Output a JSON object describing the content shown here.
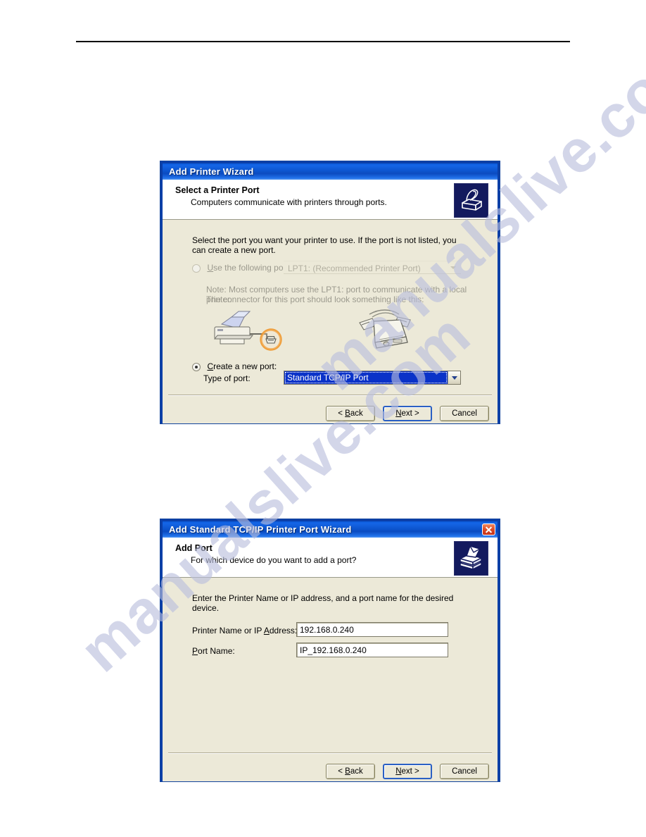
{
  "page": {
    "has_header_rule": true,
    "watermark_text": "manualslive.com",
    "watermark_color": "#b9bedd",
    "background": "#ffffff"
  },
  "dialog1": {
    "title": "Add Printer Wizard",
    "header": {
      "title": "Select a Printer Port",
      "subtitle": "Computers communicate with printers through ports.",
      "icon": "printer-icon"
    },
    "body_text": "Select the port you want your printer to use.  If the port is not listed, you can create a new port.",
    "use_existing": {
      "label_prefix": "U",
      "label": "Use the following port:",
      "selected": false,
      "disabled": true,
      "port_value": "LPT1: (Recommended Printer Port)"
    },
    "note_line1": "Note: Most computers use the LPT1: port to communicate with a local printer.",
    "note_line2": "The connector for this port should look something like this:",
    "illustration": {
      "printer": "printer-illustration",
      "connector": "parallel-connector-illustration",
      "highlight_color": "#f0962a"
    },
    "create_new": {
      "label_prefix": "C",
      "label": "Create a new port:",
      "selected": true,
      "type_label": "Type of port:",
      "type_value": "Standard TCP/IP Port",
      "highlight_color": "#0a32c8"
    },
    "buttons": {
      "back": "< Back",
      "back_accel": "B",
      "next": "Next >",
      "next_accel": "N",
      "cancel": "Cancel",
      "default_button": "next"
    }
  },
  "dialog2": {
    "title": "Add Standard TCP/IP Printer Port Wizard",
    "close_icon": "close-icon",
    "header": {
      "title": "Add Port",
      "subtitle": "For which device do you want to add a port?",
      "icon": "printer-stack-icon"
    },
    "body_text": "Enter the Printer Name or IP address, and a port name for the desired device.",
    "fields": [
      {
        "name": "printer-name-or-ip",
        "label": "Printer Name or IP Address:",
        "label_accel": "A",
        "value": "192.168.0.240"
      },
      {
        "name": "port-name",
        "label": "Port Name:",
        "label_accel": "P",
        "value": "IP_192.168.0.240"
      }
    ],
    "buttons": {
      "back": "< Back",
      "back_accel": "B",
      "next": "Next >",
      "next_accel": "N",
      "cancel": "Cancel",
      "default_button": "next"
    }
  }
}
